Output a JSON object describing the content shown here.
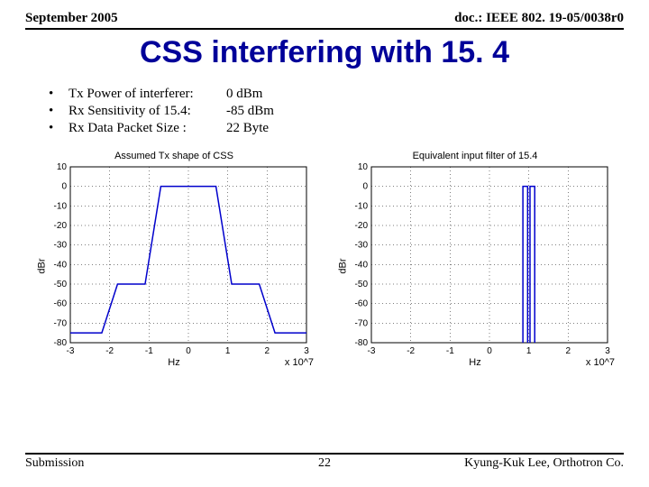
{
  "header": {
    "left": "September 2005",
    "right": "doc.: IEEE 802. 19-05/0038r0"
  },
  "title": "CSS interfering with 15. 4",
  "bullets": [
    {
      "label": "Tx Power of interferer:",
      "value": "0 dBm"
    },
    {
      "label": "Rx Sensitivity of 15.4:",
      "value": "-85 dBm"
    },
    {
      "label": "Rx Data Packet Size :",
      "value": "22 Byte"
    }
  ],
  "footer": {
    "left": "Submission",
    "center": "22",
    "right": "Kyung-Kuk Lee, Orthotron Co."
  },
  "chart_data": [
    {
      "type": "line",
      "title": "Assumed Tx shape of CSS",
      "xlabel": "Hz",
      "xmult": "x 10^7",
      "ylabel": "dBr",
      "xlim": [
        -3,
        3
      ],
      "ylim": [
        -80,
        10
      ],
      "xticks": [
        -3,
        -2,
        -1,
        0,
        1,
        2,
        3
      ],
      "yticks": [
        10,
        0,
        -10,
        -20,
        -30,
        -40,
        -50,
        -60,
        -70,
        -80
      ],
      "series": [
        {
          "name": "css_tx_mask",
          "x": [
            -3,
            -2.2,
            -1.8,
            -1.1,
            -0.7,
            0.7,
            1.1,
            1.8,
            2.2,
            3
          ],
          "y": [
            -75,
            -75,
            -50,
            -50,
            0,
            0,
            -50,
            -50,
            -75,
            -75
          ]
        }
      ]
    },
    {
      "type": "line",
      "title": "Equivalent input filter of 15.4",
      "xlabel": "Hz",
      "xmult": "x 10^7",
      "ylabel": "dBr",
      "xlim": [
        -3,
        3
      ],
      "ylim": [
        -80,
        10
      ],
      "xticks": [
        -3,
        -2,
        -1,
        0,
        1,
        2,
        3
      ],
      "yticks": [
        10,
        0,
        -10,
        -20,
        -30,
        -40,
        -50,
        -60,
        -70,
        -80
      ],
      "series": [
        {
          "name": "154_filter_left",
          "x": [
            0.85,
            0.85,
            0.97,
            0.97
          ],
          "y": [
            -80,
            0,
            0,
            -80
          ]
        },
        {
          "name": "154_filter_right",
          "x": [
            1.03,
            1.03,
            1.15,
            1.15
          ],
          "y": [
            -80,
            0,
            0,
            -80
          ]
        }
      ]
    }
  ]
}
